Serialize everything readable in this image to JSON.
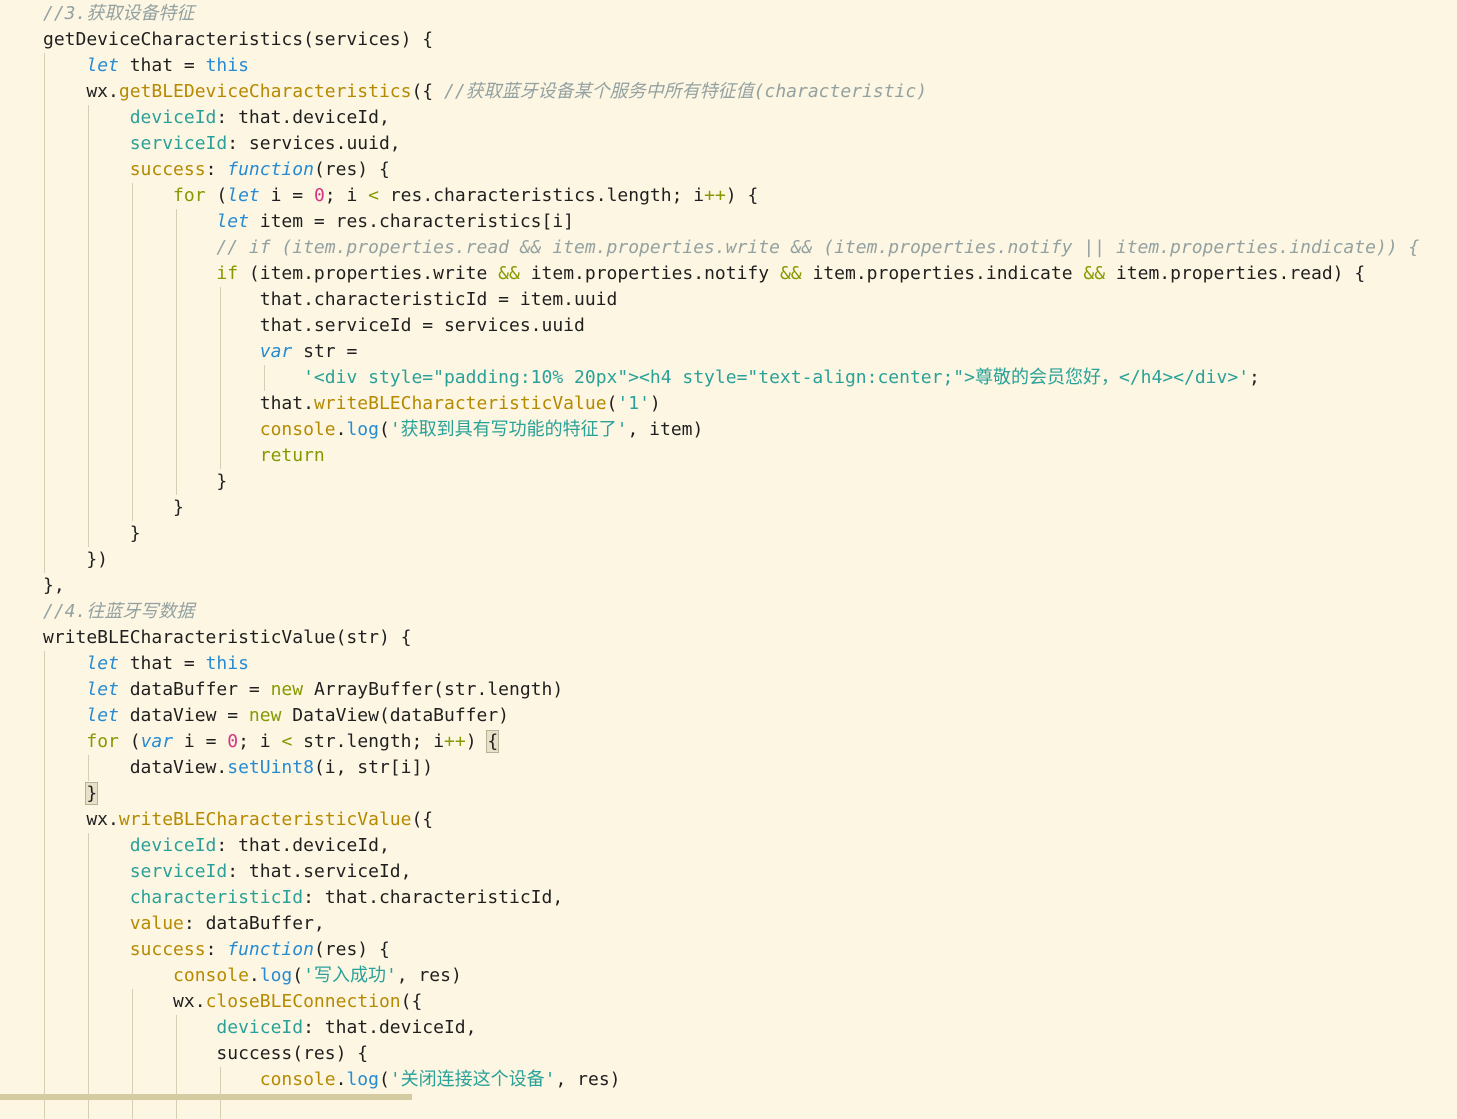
{
  "editor": {
    "lines": [
      [
        [
          "c",
          "//3.获取设备特征"
        ]
      ],
      [
        [
          "f",
          "getDeviceCharacteristics(services) {"
        ]
      ],
      [
        [
          "t",
          "    "
        ],
        [
          "k",
          "let"
        ],
        [
          "t",
          " that = "
        ],
        [
          "h",
          "this"
        ]
      ],
      [
        [
          "t",
          "    wx."
        ],
        [
          "m",
          "getBLEDeviceCharacteristics"
        ],
        [
          "t",
          "({ "
        ],
        [
          "c",
          "//获取蓝牙设备某个服务中所有特征值(characteristic)"
        ]
      ],
      [
        [
          "t",
          "        "
        ],
        [
          "y",
          "deviceId"
        ],
        [
          "t",
          ": that.deviceId,"
        ]
      ],
      [
        [
          "t",
          "        "
        ],
        [
          "y",
          "serviceId"
        ],
        [
          "t",
          ": services.uuid,"
        ]
      ],
      [
        [
          "t",
          "        "
        ],
        [
          "x",
          "success"
        ],
        [
          "t",
          ": "
        ],
        [
          "k",
          "function"
        ],
        [
          "t",
          "(res) {"
        ]
      ],
      [
        [
          "t",
          "            "
        ],
        [
          "p",
          "for"
        ],
        [
          "t",
          " ("
        ],
        [
          "k",
          "let"
        ],
        [
          "t",
          " i = "
        ],
        [
          "n",
          "0"
        ],
        [
          "t",
          "; i "
        ],
        [
          "o",
          "<"
        ],
        [
          "t",
          " res.characteristics.length; i"
        ],
        [
          "o",
          "++"
        ],
        [
          "t",
          ") {"
        ]
      ],
      [
        [
          "t",
          "                "
        ],
        [
          "k",
          "let"
        ],
        [
          "t",
          " item = res.characteristics[i]"
        ]
      ],
      [
        [
          "t",
          "                "
        ],
        [
          "c",
          "// if (item.properties.read && item.properties.write && (item.properties.notify || item.properties.indicate)) {"
        ]
      ],
      [
        [
          "t",
          "                "
        ],
        [
          "p",
          "if"
        ],
        [
          "t",
          " (item.properties.write "
        ],
        [
          "o",
          "&&"
        ],
        [
          "t",
          " item.properties.notify "
        ],
        [
          "o",
          "&&"
        ],
        [
          "t",
          " item.properties.indicate "
        ],
        [
          "o",
          "&&"
        ],
        [
          "t",
          " item.properties.read) {"
        ]
      ],
      [
        [
          "t",
          "                    that.characteristicId = item.uuid"
        ]
      ],
      [
        [
          "t",
          "                    that.serviceId = services.uuid"
        ]
      ],
      [
        [
          "t",
          "                    "
        ],
        [
          "k",
          "var"
        ],
        [
          "t",
          " str ="
        ]
      ],
      [
        [
          "t",
          "                        "
        ],
        [
          "s",
          "'<div style=\"padding:10% 20px\"><h4 style=\"text-align:center;\">尊敬的会员您好，</h4></div>'"
        ],
        [
          "t",
          ";"
        ]
      ],
      [
        [
          "t",
          "                    that."
        ],
        [
          "m",
          "writeBLECharacteristicValue"
        ],
        [
          "t",
          "("
        ],
        [
          "s",
          "'1'"
        ],
        [
          "t",
          ")"
        ]
      ],
      [
        [
          "t",
          "                    "
        ],
        [
          "x",
          "console"
        ],
        [
          "t",
          "."
        ],
        [
          "h",
          "log"
        ],
        [
          "t",
          "("
        ],
        [
          "s",
          "'获取到具有写功能的特征了'"
        ],
        [
          "t",
          ", item)"
        ]
      ],
      [
        [
          "t",
          "                    "
        ],
        [
          "p",
          "return"
        ]
      ],
      [
        [
          "t",
          "                }"
        ]
      ],
      [
        [
          "t",
          "            }"
        ]
      ],
      [
        [
          "t",
          "        }"
        ]
      ],
      [
        [
          "t",
          "    })"
        ]
      ],
      [
        [
          "t",
          "},"
        ]
      ],
      [
        [
          "c",
          "//4.往蓝牙写数据"
        ]
      ],
      [
        [
          "f",
          "writeBLECharacteristicValue(str) {"
        ]
      ],
      [
        [
          "t",
          "    "
        ],
        [
          "k",
          "let"
        ],
        [
          "t",
          " that = "
        ],
        [
          "h",
          "this"
        ]
      ],
      [
        [
          "t",
          "    "
        ],
        [
          "k",
          "let"
        ],
        [
          "t",
          " dataBuffer = "
        ],
        [
          "p",
          "new"
        ],
        [
          "t",
          " ArrayBuffer(str.length)"
        ]
      ],
      [
        [
          "t",
          "    "
        ],
        [
          "k",
          "let"
        ],
        [
          "t",
          " dataView = "
        ],
        [
          "p",
          "new"
        ],
        [
          "t",
          " DataView(dataBuffer)"
        ]
      ],
      [
        [
          "t",
          "    "
        ],
        [
          "p",
          "for"
        ],
        [
          "t",
          " ("
        ],
        [
          "k",
          "var"
        ],
        [
          "t",
          " i = "
        ],
        [
          "n",
          "0"
        ],
        [
          "t",
          "; i "
        ],
        [
          "o",
          "<"
        ],
        [
          "t",
          " str.length; i"
        ],
        [
          "o",
          "++"
        ],
        [
          "t",
          ") "
        ],
        [
          "b",
          "{"
        ]
      ],
      [
        [
          "t",
          "        dataView."
        ],
        [
          "h",
          "setUint8"
        ],
        [
          "t",
          "(i, str[i])"
        ]
      ],
      [
        [
          "t",
          "    "
        ],
        [
          "b",
          "}"
        ]
      ],
      [
        [
          "t",
          "    wx."
        ],
        [
          "m",
          "writeBLECharacteristicValue"
        ],
        [
          "t",
          "({"
        ]
      ],
      [
        [
          "t",
          "        "
        ],
        [
          "y",
          "deviceId"
        ],
        [
          "t",
          ": that.deviceId,"
        ]
      ],
      [
        [
          "t",
          "        "
        ],
        [
          "y",
          "serviceId"
        ],
        [
          "t",
          ": that.serviceId,"
        ]
      ],
      [
        [
          "t",
          "        "
        ],
        [
          "y",
          "characteristicId"
        ],
        [
          "t",
          ": that.characteristicId,"
        ]
      ],
      [
        [
          "t",
          "        "
        ],
        [
          "x",
          "value"
        ],
        [
          "t",
          ": dataBuffer,"
        ]
      ],
      [
        [
          "t",
          "        "
        ],
        [
          "x",
          "success"
        ],
        [
          "t",
          ": "
        ],
        [
          "k",
          "function"
        ],
        [
          "t",
          "(res) {"
        ]
      ],
      [
        [
          "t",
          "            "
        ],
        [
          "x",
          "console"
        ],
        [
          "t",
          "."
        ],
        [
          "h",
          "log"
        ],
        [
          "t",
          "("
        ],
        [
          "s",
          "'写入成功'"
        ],
        [
          "t",
          ", res)"
        ]
      ],
      [
        [
          "t",
          "            wx."
        ],
        [
          "m",
          "closeBLEConnection"
        ],
        [
          "t",
          "({"
        ]
      ],
      [
        [
          "t",
          "                "
        ],
        [
          "y",
          "deviceId"
        ],
        [
          "t",
          ": that.deviceId,"
        ]
      ],
      [
        [
          "t",
          "                success(res) {"
        ]
      ],
      [
        [
          "t",
          "                    "
        ],
        [
          "x",
          "console"
        ],
        [
          "t",
          "."
        ],
        [
          "h",
          "log"
        ],
        [
          "t",
          "("
        ],
        [
          "s",
          "'关闭连接这个设备'"
        ],
        [
          "t",
          ", res)"
        ]
      ]
    ]
  }
}
